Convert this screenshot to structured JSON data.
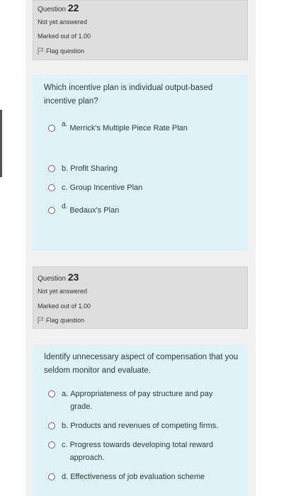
{
  "q22": {
    "question_word": "Question",
    "number": "22",
    "status": "Not yet answered",
    "marked": "Marked out of 1.00",
    "flag": "Flag question",
    "text": "Which incentive plan is individual output-based incentive plan?",
    "options": [
      {
        "letter": "a.",
        "text": "Merrick's Multiple Piece Rate Plan"
      },
      {
        "letter": "b.",
        "text": "Profit Sharing"
      },
      {
        "letter": "c.",
        "text": "Group Incentive Plan"
      },
      {
        "letter": "d.",
        "text": "Bedaux's Plan"
      }
    ]
  },
  "q23": {
    "question_word": "Question",
    "number": "23",
    "status": "Not yet answered",
    "marked": "Marked out of 1.00",
    "flag": "Flag question",
    "text": "Identify unnecessary aspect of compensation that you seldom monitor and evaluate.",
    "options": [
      {
        "letter": "a.",
        "text": "Appropriateness of pay structure and pay grade."
      },
      {
        "letter": "b.",
        "text": "Products and revenues of competing firms."
      },
      {
        "letter": "c.",
        "text": "Progress towards developing total reward approach."
      },
      {
        "letter": "d.",
        "text": "Effectiveness of job evaluation scheme"
      }
    ]
  },
  "colors": {
    "info_bg": "#dedede",
    "question_bg": "#def2f8",
    "page_bg": "#f1f1f1"
  },
  "icons": {
    "flag": "flag-icon",
    "radio": "radio-button"
  }
}
